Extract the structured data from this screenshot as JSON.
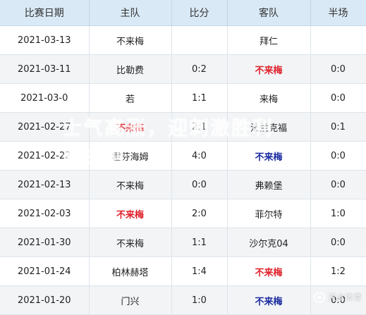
{
  "table": {
    "headers": [
      "比赛日期",
      "主队",
      "比分",
      "客队",
      "半场"
    ],
    "rows": [
      {
        "date": "2021-03-13",
        "home": "不来梅",
        "score": "",
        "away": "拜仁",
        "half": "",
        "home_style": "plain",
        "away_style": "plain"
      },
      {
        "date": "2021-03-11",
        "home": "比勒费",
        "score": "0:2",
        "away": "不来梅",
        "half": "0:0",
        "home_style": "plain",
        "away_style": "red"
      },
      {
        "date": "2021-03-0",
        "home": "若",
        "score": "1:1",
        "away": "来梅",
        "half": "0:0",
        "home_style": "plain",
        "away_style": "plain"
      },
      {
        "date": "2021-02-27",
        "home": "不来梅",
        "score": "2:1",
        "away": "法兰克福",
        "half": "0:1",
        "home_style": "red",
        "away_style": "plain"
      },
      {
        "date": "2021-02-22",
        "home": "霍芬海姆",
        "score": "4:0",
        "away": "不来梅",
        "half": "0:0",
        "home_style": "plain",
        "away_style": "blue"
      },
      {
        "date": "2021-02-13",
        "home": "不来梅",
        "score": "0:0",
        "away": "弗赖堡",
        "half": "0:0",
        "home_style": "plain",
        "away_style": "plain"
      },
      {
        "date": "2021-02-03",
        "home": "不来梅",
        "score": "2:0",
        "away": "菲尔特",
        "half": "1:0",
        "home_style": "red",
        "away_style": "plain"
      },
      {
        "date": "2021-01-30",
        "home": "不来梅",
        "score": "1:1",
        "away": "沙尔克04",
        "half": "0:0",
        "home_style": "plain",
        "away_style": "plain"
      },
      {
        "date": "2021-01-24",
        "home": "柏林赫塔",
        "score": "1:4",
        "away": "不来梅",
        "half": "1:2",
        "home_style": "plain",
        "away_style": "red"
      },
      {
        "date": "2021-01-20",
        "home": "门兴",
        "score": "1:0",
        "away": "不来梅",
        "half": "0:0",
        "home_style": "plain",
        "away_style": "blue"
      }
    ]
  },
  "overlay": {
    "text": "士气高涨，迎刺激胜利",
    "text2": "看球吧"
  },
  "watermark": {
    "text": "天水体育"
  },
  "colors": {
    "header_bg": "#d9e9f5",
    "win_red": "#e0202a",
    "loss_blue": "#1a2aa0",
    "row_alt_bg": "#f2f4f6"
  }
}
